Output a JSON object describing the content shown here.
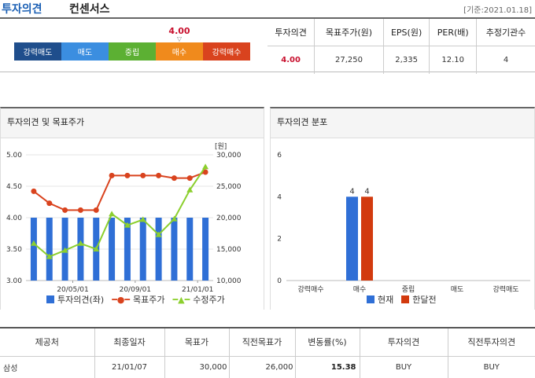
{
  "header": {
    "title_strong": "투자의견",
    "title_rest": "컨센서스",
    "basis": "[기준:2021.01.18]"
  },
  "opinion_scale": {
    "labels": [
      "강력매도",
      "매도",
      "중립",
      "매수",
      "강력매수"
    ],
    "colors": [
      "#1f4e8c",
      "#3b8ee0",
      "#5cb033",
      "#f08a1c",
      "#d9431e"
    ],
    "current_value": "4.00",
    "current_score": 4.0
  },
  "summary": {
    "headers": [
      "투자의견",
      "목표주가(원)",
      "EPS(원)",
      "PER(배)",
      "추정기관수"
    ],
    "values": [
      "4.00",
      "27,250",
      "2,335",
      "12.10",
      "4"
    ]
  },
  "left_panel": {
    "title": "투자의견 및 목표주가",
    "unit": "[원]",
    "legend": [
      "투자의견(좌)",
      "목표주가",
      "수정주가"
    ]
  },
  "right_panel": {
    "title": "투자의견 분포",
    "legend": [
      "현재",
      "한달전"
    ]
  },
  "chart_data": [
    {
      "type": "bar+line",
      "x_ticks": [
        "20/05/01",
        "20/09/01",
        "21/01/01"
      ],
      "y_left_ticks": [
        "5.00",
        "4.50",
        "4.00",
        "3.50",
        "3.00"
      ],
      "y_left_range": [
        3.0,
        5.0
      ],
      "y_right_ticks": [
        "30,000",
        "25,000",
        "20,000",
        "15,000",
        "10,000"
      ],
      "y_right_range": [
        10000,
        30000
      ],
      "series": [
        {
          "name": "투자의견(좌)",
          "type": "bar",
          "axis": "left",
          "color": "#2f6fd6",
          "values": [
            4,
            4,
            4,
            4,
            4,
            4,
            4,
            4,
            4,
            4,
            4,
            4
          ]
        },
        {
          "name": "목표주가",
          "type": "line",
          "axis": "right",
          "color": "#d9431e",
          "values": [
            24200,
            22300,
            21200,
            21200,
            21200,
            26700,
            26700,
            26700,
            26700,
            26300,
            26300,
            27250
          ]
        },
        {
          "name": "수정주가",
          "type": "line",
          "axis": "right",
          "color": "#8ccf2e",
          "values": [
            15900,
            13800,
            14800,
            15900,
            15000,
            20600,
            18800,
            19700,
            17300,
            19800,
            24400,
            28100
          ]
        }
      ]
    },
    {
      "type": "bar",
      "categories": [
        "강력매수",
        "매수",
        "중립",
        "매도",
        "강력매도"
      ],
      "y_ticks": [
        "6",
        "4",
        "2",
        "0"
      ],
      "ylim": [
        0,
        6
      ],
      "series": [
        {
          "name": "현재",
          "color": "#2f6fd6",
          "values": [
            0,
            4,
            0,
            0,
            0
          ]
        },
        {
          "name": "한달전",
          "color": "#d23a0e",
          "values": [
            0,
            4,
            0,
            0,
            0
          ]
        }
      ]
    }
  ],
  "detail": {
    "headers": [
      "제공처",
      "최종일자",
      "목표가",
      "직전목표가",
      "변동률(%)",
      "투자의견",
      "직전투자의견"
    ],
    "rows": [
      [
        "삼성",
        "21/01/07",
        "30,000",
        "26,000",
        "15.38",
        "BUY",
        "BUY"
      ]
    ]
  }
}
